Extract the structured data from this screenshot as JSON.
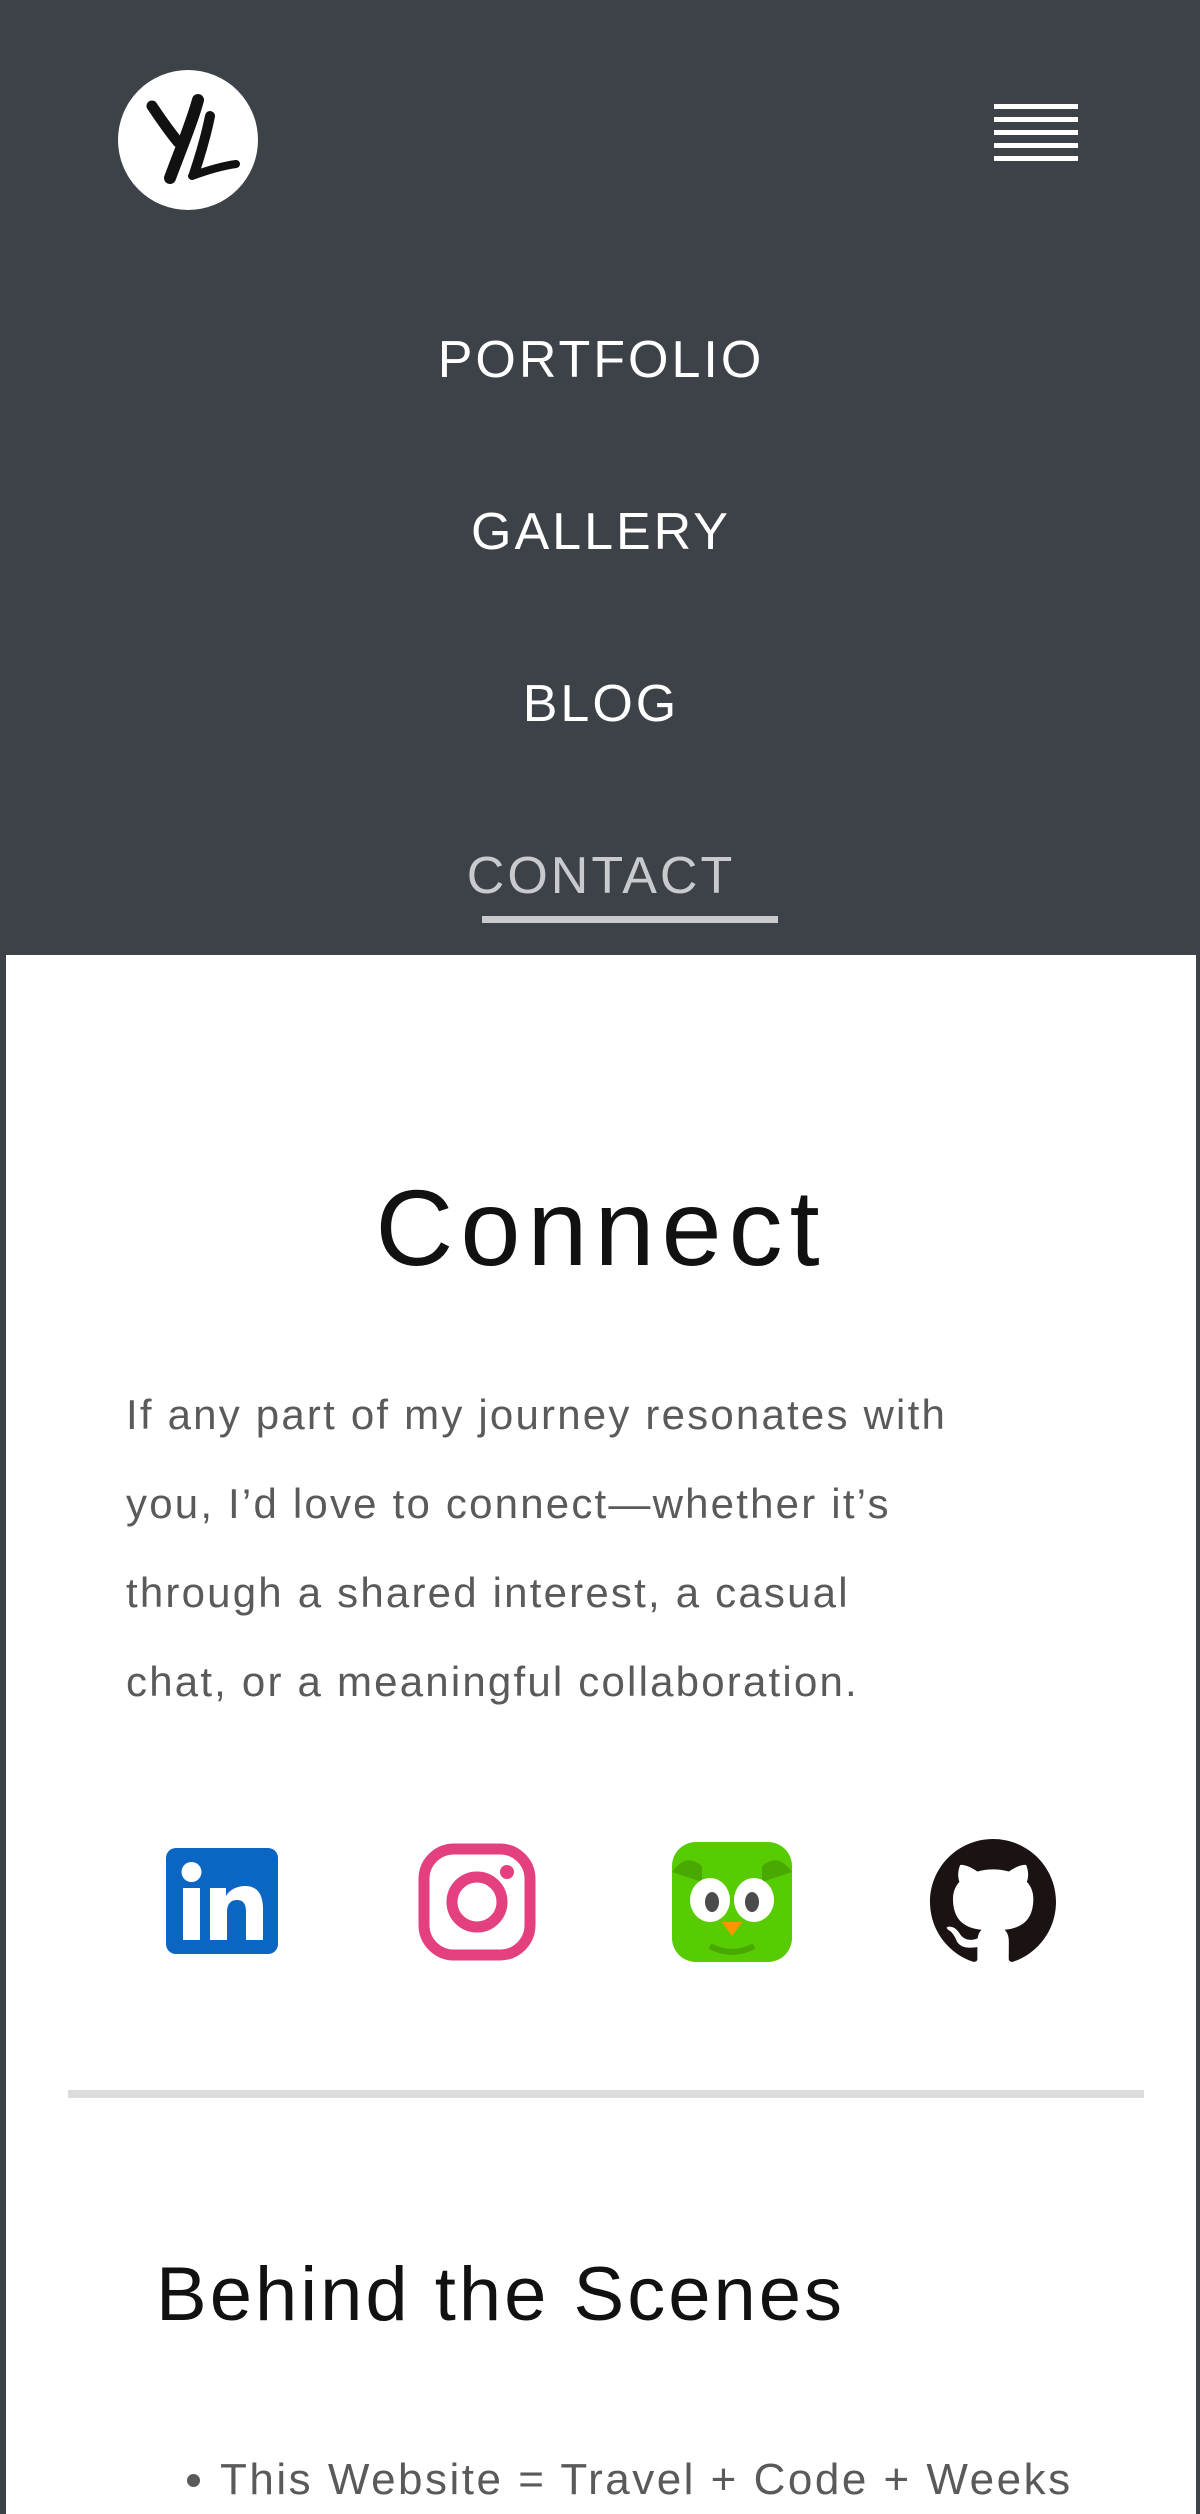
{
  "header": {
    "logo_text": "YL",
    "menu_icon": "hamburger-icon",
    "nav": {
      "portfolio": "PORTFOLIO",
      "gallery": "GALLERY",
      "blog": "BLOG",
      "contact": "CONTACT"
    },
    "active_item": "CONTACT",
    "background_color": "#3d4248"
  },
  "main": {
    "title": "Connect",
    "intro_lines": [
      "If any part of my journey resonates with",
      "you, I’d love to connect—whether it’s",
      "through a shared interest, a casual",
      "chat, or a meaningful collaboration."
    ],
    "social_links": [
      {
        "icon": "linkedin-icon",
        "color": "#0a66c2"
      },
      {
        "icon": "instagram-icon",
        "color": "#e4407f"
      },
      {
        "icon": "duolingo-icon",
        "color": "#58cc02"
      },
      {
        "icon": "github-icon",
        "color": "#1b1313"
      }
    ]
  },
  "behind_the_scenes": {
    "title": "Behind the Scenes",
    "items": [
      "This Website = Travel + Code + Weeks"
    ]
  }
}
